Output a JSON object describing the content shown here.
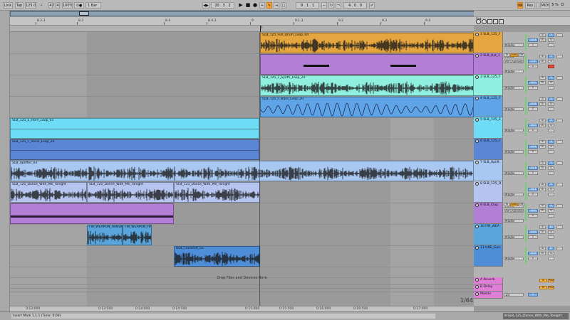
{
  "toolbar": {
    "link_label": "Link",
    "tap_label": "Tap",
    "tempo": "125.00",
    "time_sig_num": "4",
    "time_sig_den": "4",
    "zoom": "100%",
    "quantize": "1 Bar",
    "position": "20 . 3 . 2",
    "punch_start": "9 . 1 . 1",
    "loop_length": "4 . 0 . 0",
    "key_label": "Key",
    "midi_label": "MIDI",
    "cpu": "5 %",
    "d_label": "D"
  },
  "ruler": {
    "labels": [
      "8.2.3",
      "8.3",
      "8.4",
      "8.4.3",
      "9",
      "9.1.3",
      "9.2",
      "9.3",
      "9.4"
    ],
    "marker": "1"
  },
  "bottom_ruler": {
    "labels": [
      "0:13:000",
      "0:13:500",
      "0:14:000",
      "0:14:500",
      "0:15:000",
      "0:15:500",
      "0:16:000",
      "0:16:500",
      "0:17:000"
    ]
  },
  "zoom_fraction": "1/64",
  "drop_zone": "Drop Files and Devices Here",
  "clips": [
    {
      "title": "SLB_125_Full_Drum_Loop_04",
      "color": "#e5a63f"
    },
    {
      "title": "SLB_125_F_Synth_Loop_24",
      "color": "#8ff0e0"
    },
    {
      "title": "SLB_125_F_Bass_Loop_20",
      "color": "#5ea4e6"
    },
    {
      "title": "SLB_125_E_Horn_Loop_01",
      "color": "#6fdcf5"
    },
    {
      "title": "SLB_125_F_Vocal_Loop_24",
      "color": "#5b86d6"
    },
    {
      "title": "SLB_Uplifter_03",
      "color": "#a8c8f2"
    },
    {
      "title": "SLB_125_Dance_With_Me_Tonight",
      "color": "#b5c5f0"
    },
    {
      "title": "SLB_125_Dance_With_Me_Tonight",
      "color": "#b5c5f0"
    },
    {
      "title": "SLB_125_Dance_With_Me_Tonight",
      "color": "#b5c5f0"
    },
    {
      "title": "FW_WEAPON_HANDHELD",
      "color": "#5aa6dc"
    },
    {
      "title": "FW_WEAPON_HAN",
      "color": "#5aa6dc"
    },
    {
      "title": "UDE_Gunshot_03",
      "color": "#4e8ed8"
    }
  ],
  "tracks": [
    {
      "name": "1 SLB_125_F",
      "color": "#e5a63f",
      "volume": "-10.3",
      "output": "Master"
    },
    {
      "name": "2 SLB_Hat_1",
      "color": "#b27ed6",
      "input": "All Ins",
      "channel": "All Channels",
      "monitor": "Auto",
      "volume": "-1.3",
      "output": "Master"
    },
    {
      "name": "3 SLB_125_F",
      "color": "#8ff0e0",
      "volume": "-10.0",
      "output": "Master"
    },
    {
      "name": "4 SLB_125_F",
      "color": "#5ea4e6",
      "volume": "-12.8",
      "output": "Master"
    },
    {
      "name": "5 SLB_125_E",
      "color": "#6fdcf5",
      "volume": "-26.0",
      "output": "Master"
    },
    {
      "name": "6 SLB_125_F",
      "color": "#5b86d6",
      "volume": "-14.6",
      "output": "Master"
    },
    {
      "name": "7 SLB_Uplift",
      "color": "#a8c8f2",
      "volume": "-15.3",
      "output": "Master"
    },
    {
      "name": "8 SLB_125_D",
      "color": "#b5c5f0",
      "volume": "-18.4",
      "output": "Master"
    },
    {
      "name": "9 SLB_Clap",
      "color": "#b27ed6",
      "input": "All Ins",
      "channel": "All Channels",
      "monitor": "Auto",
      "volume": "-10.0",
      "output": "Master"
    },
    {
      "name": "10 FW_WEA",
      "color": "#5aa6dc",
      "volume": "-13.0",
      "output": "Master"
    },
    {
      "name": "11 UDE_Gun",
      "color": "#4e8ed8",
      "volume": "-12.8",
      "output": "Master"
    }
  ],
  "returns": [
    {
      "name": "A Reverb",
      "color": "#e07fd8"
    },
    {
      "name": "B Delay",
      "color": "#e07fd8"
    }
  ],
  "master": {
    "name": "Master",
    "color": "#e07fd8",
    "output": "1/2"
  },
  "mixer_labels": {
    "solo": "S",
    "post": "Post",
    "auto": "Auto",
    "in": "In",
    "off": "Off",
    "a": "A",
    "b": "B"
  },
  "status": {
    "message": "Insert Mark 1.1.1 (Time: 0:00)",
    "selected_track": "8-SLB_125_Dance_With_Me_Tonight"
  },
  "colors": {
    "accent_orange": "#f2a33a",
    "accent_blue": "#7fb1e6",
    "arm_red": "#e14b3b"
  }
}
